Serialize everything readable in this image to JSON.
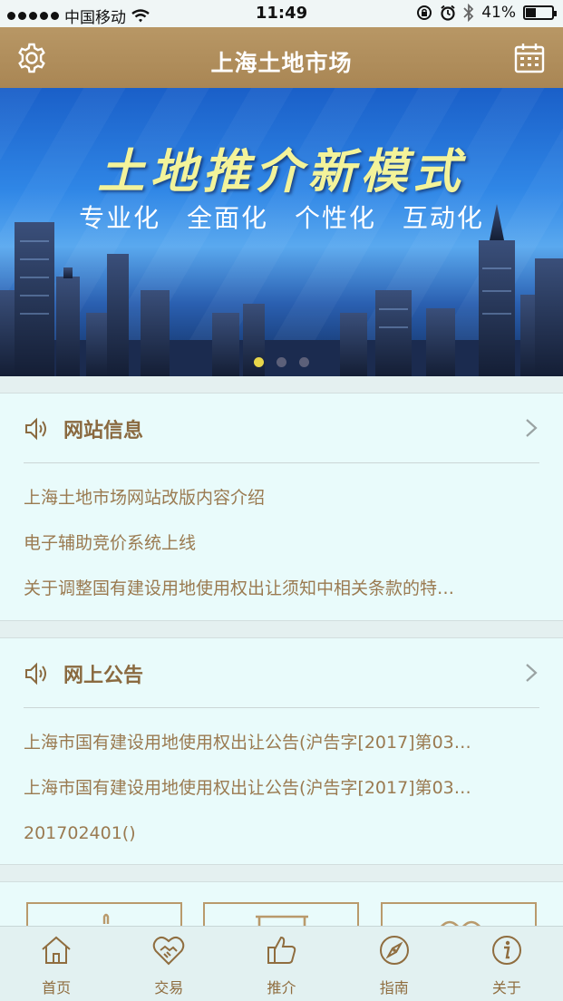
{
  "status_bar": {
    "carrier": "中国移动",
    "time": "11:49",
    "battery": "41%",
    "battery_level": 0.41
  },
  "header": {
    "title": "上海土地市场",
    "left_icon": "gear-icon",
    "right_icon": "calendar-icon"
  },
  "banner": {
    "headline": "土地推介新模式",
    "subtitle": "专业化  全面化  个性化  互动化",
    "page_count": 3,
    "active_page": 1
  },
  "site_info": {
    "title": "网站信息",
    "items": [
      "上海土地市场网站改版内容介绍",
      "电子辅助竞价系统上线",
      "关于调整国有建设用地使用权出让须知中相关条款的特…"
    ]
  },
  "announcements": {
    "title": "网上公告",
    "items": [
      "上海市国有建设用地使用权出让公告(沪告字[2017]第03…",
      "上海市国有建设用地使用权出让公告(沪告字[2017]第03…",
      "201702401()"
    ]
  },
  "tabbar": {
    "items": [
      {
        "label": "首页",
        "icon": "home-icon"
      },
      {
        "label": "交易",
        "icon": "handshake-icon"
      },
      {
        "label": "推介",
        "icon": "thumbs-up-icon"
      },
      {
        "label": "指南",
        "icon": "compass-icon"
      },
      {
        "label": "关于",
        "icon": "info-icon"
      }
    ]
  },
  "colors": {
    "header": "#a98654",
    "accent_text": "#9a7a50",
    "background": "#e9fbfb"
  }
}
